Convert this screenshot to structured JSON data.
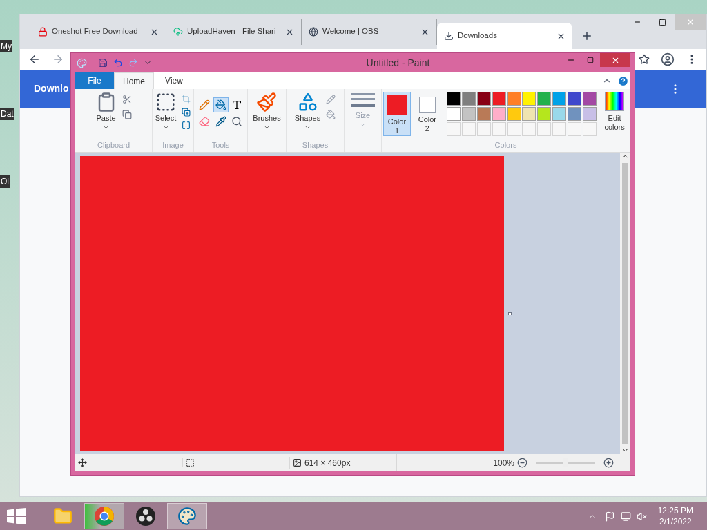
{
  "desktop": {
    "icons": [
      {
        "label": "My"
      },
      {
        "label": "Dat"
      },
      {
        "label": "Ol"
      }
    ]
  },
  "browser": {
    "tabs": [
      {
        "title": "Oneshot Free Download",
        "kind": "lock",
        "selected": false
      },
      {
        "title": "UploadHaven - File Shari",
        "kind": "upload",
        "selected": false
      },
      {
        "title": "Welcome | OBS",
        "kind": "globe",
        "selected": false
      },
      {
        "title": "Downloads",
        "kind": "download",
        "selected": true
      }
    ],
    "header": {
      "title": "Downlo"
    }
  },
  "paint": {
    "title": "Untitled - Paint",
    "ribbon_tabs": [
      {
        "label": "File",
        "kind": "file",
        "selected": false
      },
      {
        "label": "Home",
        "kind": "tab",
        "selected": true
      },
      {
        "label": "View",
        "kind": "tab",
        "selected": false
      }
    ],
    "groups": {
      "clipboard": "Clipboard",
      "image": "Image",
      "tools": "Tools",
      "shapes": "Shapes",
      "colors": "Colors"
    },
    "paste": "Paste",
    "select": "Select",
    "brushes": "Brushes",
    "shapes_button": "Shapes",
    "size": "Size",
    "tools": [
      {
        "kind": "pencil",
        "selected": false
      },
      {
        "kind": "fill",
        "selected": true
      },
      {
        "kind": "text",
        "selected": false
      },
      {
        "kind": "eraser",
        "selected": false
      },
      {
        "kind": "picker",
        "selected": false
      },
      {
        "kind": "magnifier",
        "selected": false
      }
    ],
    "color_slots": [
      {
        "label": "Color",
        "sub": "1",
        "color": "#ed1c24",
        "selected": true
      },
      {
        "label": "Color",
        "sub": "2",
        "color": "#ffffff",
        "selected": false
      }
    ],
    "palette": [
      {
        "color": "#000000"
      },
      {
        "color": "#7f7f7f"
      },
      {
        "color": "#880015"
      },
      {
        "color": "#ed1c24"
      },
      {
        "color": "#ff7f27"
      },
      {
        "color": "#fff200"
      },
      {
        "color": "#22b14c"
      },
      {
        "color": "#00a2e8"
      },
      {
        "color": "#3f48cc"
      },
      {
        "color": "#a349a4"
      },
      {
        "color": "#ffffff"
      },
      {
        "color": "#c3c3c3"
      },
      {
        "color": "#b97a57"
      },
      {
        "color": "#ffaec9"
      },
      {
        "color": "#ffc90e"
      },
      {
        "color": "#efe4b0"
      },
      {
        "color": "#b5e61d"
      },
      {
        "color": "#99d9ea"
      },
      {
        "color": "#7092be"
      },
      {
        "color": "#c8bfe7"
      },
      {
        "kind": "empty"
      },
      {
        "kind": "empty"
      },
      {
        "kind": "empty"
      },
      {
        "kind": "empty"
      },
      {
        "kind": "empty"
      },
      {
        "kind": "empty"
      },
      {
        "kind": "empty"
      },
      {
        "kind": "empty"
      },
      {
        "kind": "empty"
      },
      {
        "kind": "empty"
      }
    ],
    "edit_colors": "Edit colors",
    "status": {
      "dimensions": "614 × 460px",
      "zoom": "100%",
      "zoom_slider": {
        "level": 0.5
      }
    }
  },
  "taskbar": {
    "apps": [
      {
        "kind": "explorer",
        "selected": false
      },
      {
        "kind": "chrome",
        "selected": true
      },
      {
        "kind": "obs",
        "selected": false
      },
      {
        "kind": "paint",
        "selected": true
      }
    ],
    "time": "12:25 PM",
    "date": "2/1/2022"
  }
}
